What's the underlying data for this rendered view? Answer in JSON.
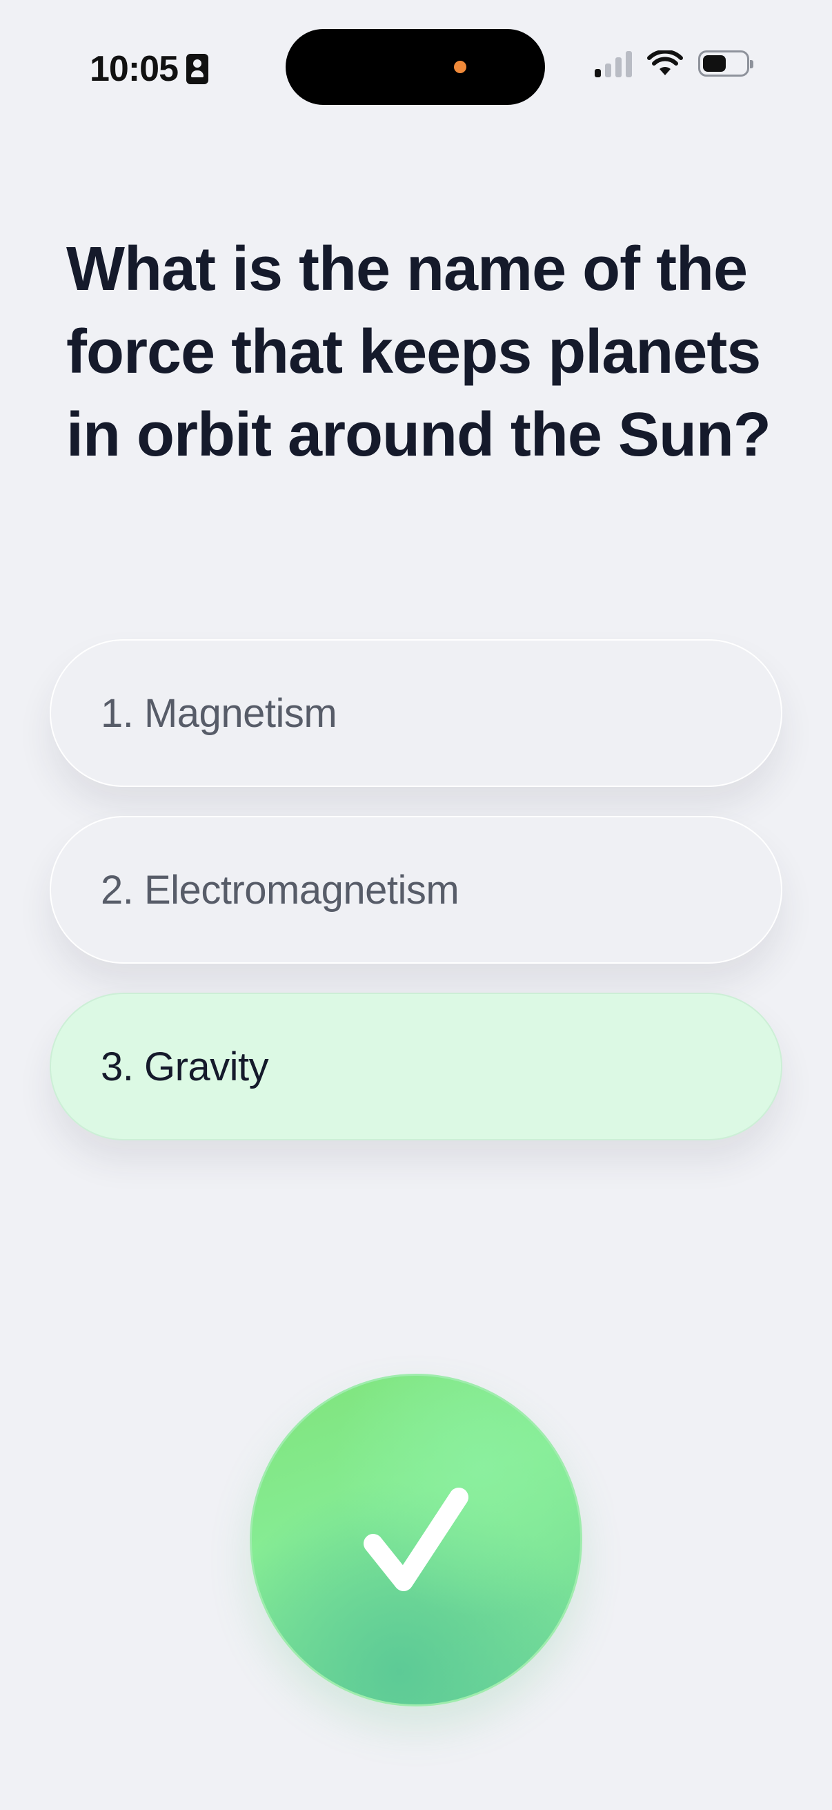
{
  "status_bar": {
    "time": "10:05",
    "battery_level": 0.55
  },
  "question": {
    "text": "What is the name of the force that keeps planets in orbit around the Sun?"
  },
  "options": [
    {
      "label": "1. Magnetism",
      "selected": false
    },
    {
      "label": "2. Electromagnetism",
      "selected": false
    },
    {
      "label": "3. Gravity",
      "selected": true
    }
  ],
  "colors": {
    "background": "#f0f1f5",
    "selected_option": "#dcf9e4",
    "confirm_green": "#7fe37a",
    "text_dark": "#151a2b",
    "text_muted": "#575c68"
  },
  "icons": {
    "status": [
      "id-badge-icon",
      "signal-icon",
      "wifi-icon",
      "battery-icon"
    ],
    "confirm": "checkmark-icon"
  }
}
